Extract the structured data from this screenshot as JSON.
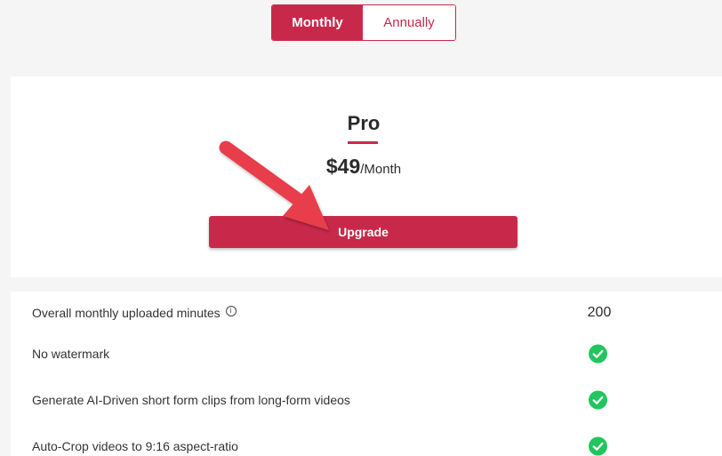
{
  "billing_toggle": {
    "options": [
      {
        "label": "Monthly",
        "selected": true
      },
      {
        "label": "Annually",
        "selected": false
      }
    ]
  },
  "plan": {
    "name": "Pro",
    "price": "$49",
    "period": "/Month",
    "cta_label": "Upgrade"
  },
  "features": [
    {
      "label": "Overall monthly uploaded minutes",
      "value": "200",
      "info_icon": true,
      "included": null
    },
    {
      "label": "No watermark",
      "value": null,
      "info_icon": false,
      "included": true
    },
    {
      "label": "Generate AI-Driven short form clips from long-form videos",
      "value": null,
      "info_icon": false,
      "included": true
    },
    {
      "label": "Auto-Crop videos to 9:16 aspect-ratio",
      "value": null,
      "info_icon": false,
      "included": true
    }
  ],
  "icons": {
    "info": "info-icon",
    "check": "check-circle-icon",
    "annotation": "arrow-annotation"
  },
  "colors": {
    "brand": "#c8294a",
    "check": "#22c55e",
    "annotation_arrow": "#e83c4b"
  }
}
